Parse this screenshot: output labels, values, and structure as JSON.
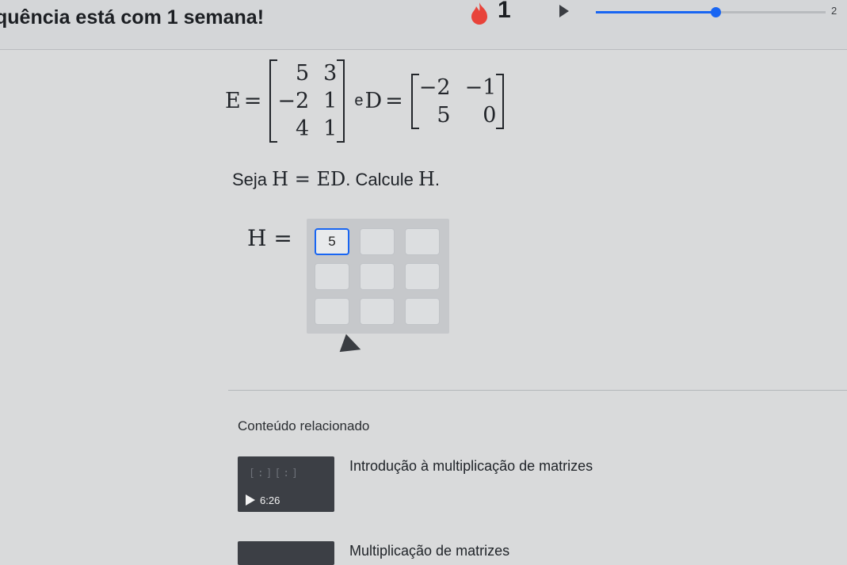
{
  "header": {
    "streak_text": "quência está com 1 semana!",
    "streak_count": "1",
    "progress_end_label": "2",
    "progress_fraction": 0.52,
    "accent_color": "#1865f2",
    "flame_color": "#e8433a"
  },
  "question": {
    "E_label": "E",
    "E_matrix": [
      [
        "5",
        "3"
      ],
      [
        "−2",
        "1"
      ],
      [
        "4",
        "1"
      ]
    ],
    "and_word": "e",
    "D_label": "D",
    "D_matrix": [
      [
        "−2",
        "−1"
      ],
      [
        "5",
        "0"
      ]
    ],
    "prompt_prefix": "Seja",
    "prompt_math": "H = ED",
    "prompt_suffix": ". Calcule",
    "prompt_target": "H",
    "prompt_end": ".",
    "answer_label": "H =",
    "answer_cells": [
      "5",
      "",
      "",
      "",
      "",
      "",
      "",
      "",
      ""
    ]
  },
  "related": {
    "title": "Conteúdo relacionado",
    "videos": [
      {
        "title": "Introdução à multiplicação de matrizes",
        "duration": "6:26"
      },
      {
        "title": "Multiplicação de matrizes",
        "duration": ""
      }
    ]
  },
  "icons": {
    "flame": "flame-icon",
    "play_small": "play-icon",
    "cursor": "cursor-arrow-icon",
    "video_play": "play-icon"
  }
}
